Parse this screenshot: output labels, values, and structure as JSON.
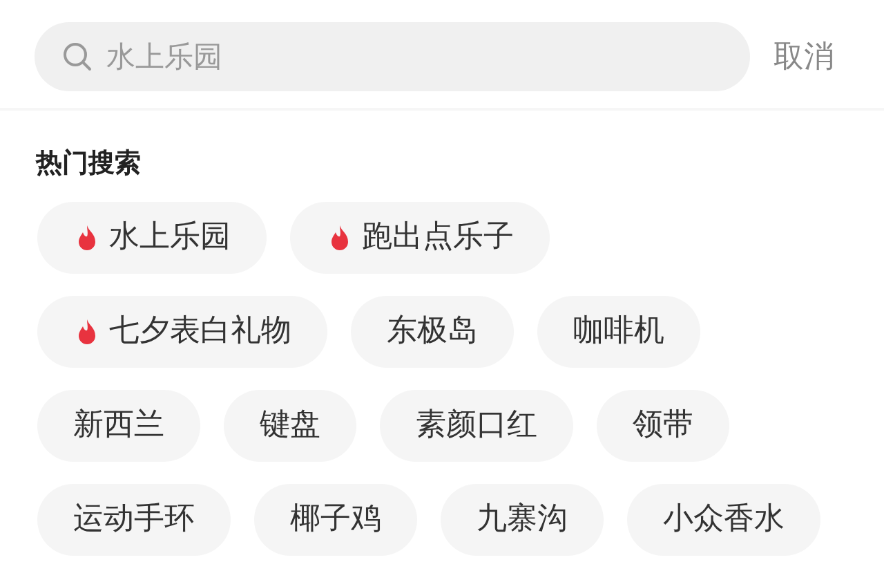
{
  "search": {
    "placeholder": "水上乐园",
    "cancel": "取消"
  },
  "hot_searches": {
    "title": "热门搜索",
    "items": [
      {
        "label": "水上乐园",
        "hot": true
      },
      {
        "label": "跑出点乐子",
        "hot": true
      },
      {
        "label": "七夕表白礼物",
        "hot": true
      },
      {
        "label": "东极岛",
        "hot": false
      },
      {
        "label": "咖啡机",
        "hot": false
      },
      {
        "label": "新西兰",
        "hot": false
      },
      {
        "label": "键盘",
        "hot": false
      },
      {
        "label": "素颜口红",
        "hot": false
      },
      {
        "label": "领带",
        "hot": false
      },
      {
        "label": "运动手环",
        "hot": false
      },
      {
        "label": "椰子鸡",
        "hot": false
      },
      {
        "label": "九寨沟",
        "hot": false
      },
      {
        "label": "小众香水",
        "hot": false
      }
    ]
  }
}
